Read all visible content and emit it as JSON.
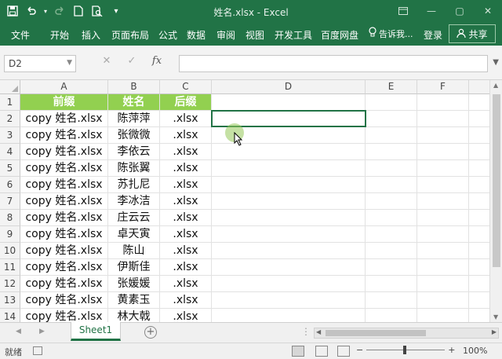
{
  "window": {
    "title": "姓名.xlsx - Excel",
    "minimize": "—",
    "restore": "▢",
    "close": "✕"
  },
  "ribbon": {
    "tabs": [
      "文件",
      "开始",
      "插入",
      "页面布局",
      "公式",
      "数据",
      "审阅",
      "视图",
      "开发工具",
      "百度网盘"
    ],
    "tell_me": "告诉我...",
    "login": "登录",
    "share": "共享"
  },
  "formula_bar": {
    "name_box": "D2",
    "cancel": "✕",
    "enter": "✓",
    "fx": "fx",
    "content": ""
  },
  "columns": [
    "A",
    "B",
    "C",
    "D",
    "E",
    "F"
  ],
  "rows": [
    {
      "num": "1",
      "a": "前缀",
      "b": "姓名",
      "c": "后缀"
    },
    {
      "num": "2",
      "a": "copy 姓名.xlsx",
      "b": "陈萍萍",
      "c": ".xlsx"
    },
    {
      "num": "3",
      "a": "copy 姓名.xlsx",
      "b": "张微微",
      "c": ".xlsx"
    },
    {
      "num": "4",
      "a": "copy 姓名.xlsx",
      "b": "李依云",
      "c": ".xlsx"
    },
    {
      "num": "5",
      "a": "copy 姓名.xlsx",
      "b": "陈张翼",
      "c": ".xlsx"
    },
    {
      "num": "6",
      "a": "copy 姓名.xlsx",
      "b": "苏扎尼",
      "c": ".xlsx"
    },
    {
      "num": "7",
      "a": "copy 姓名.xlsx",
      "b": "李冰洁",
      "c": ".xlsx"
    },
    {
      "num": "8",
      "a": "copy 姓名.xlsx",
      "b": "庄云云",
      "c": ".xlsx"
    },
    {
      "num": "9",
      "a": "copy 姓名.xlsx",
      "b": "卓天寅",
      "c": ".xlsx"
    },
    {
      "num": "10",
      "a": "copy 姓名.xlsx",
      "b": "陈山",
      "c": ".xlsx"
    },
    {
      "num": "11",
      "a": "copy 姓名.xlsx",
      "b": "伊斯佳",
      "c": ".xlsx"
    },
    {
      "num": "12",
      "a": "copy 姓名.xlsx",
      "b": "张媛媛",
      "c": ".xlsx"
    },
    {
      "num": "13",
      "a": "copy 姓名.xlsx",
      "b": "黄素玉",
      "c": ".xlsx"
    },
    {
      "num": "14",
      "a": "copy 姓名.xlsx",
      "b": "林大戟",
      "c": ".xlsx"
    }
  ],
  "sheets": [
    "Sheet1"
  ],
  "status": {
    "ready": "就绪",
    "zoom": "100%",
    "zoom_minus": "−",
    "zoom_plus": "+"
  },
  "colors": {
    "accent": "#217346",
    "header_fill": "#92d050"
  }
}
